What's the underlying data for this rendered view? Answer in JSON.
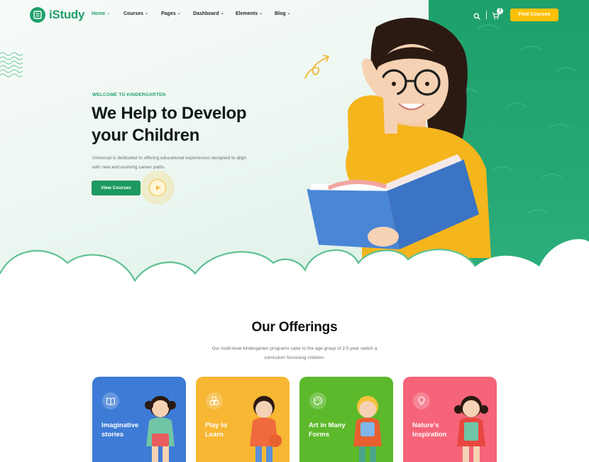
{
  "brand": {
    "name": "iStudy"
  },
  "nav": {
    "items": [
      {
        "label": "Home",
        "active": true
      },
      {
        "label": "Courses",
        "active": false
      },
      {
        "label": "Pages",
        "active": false
      },
      {
        "label": "Dashboard",
        "active": false
      },
      {
        "label": "Elements",
        "active": false
      },
      {
        "label": "Blog",
        "active": false
      }
    ],
    "cart_count": "3",
    "cta_label": "Find Courses"
  },
  "hero": {
    "eyebrow": "WELCOME TO KINDERGARTEN",
    "title_line1": "We Help to Develop",
    "title_line2": "your Children",
    "description": "Universal is dedicated to offering educational experiences designed to align with new and evolving career paths.",
    "button_label": "View Courses"
  },
  "offerings": {
    "title": "Our Offerings",
    "description": "Our multi-level kindergarten programs cater to the age group of 2-5 year switch a curriculum focussing children.",
    "cards": [
      {
        "line1": "Imaginative",
        "line2": "stories",
        "icon": "book-icon",
        "color": "#3d7bd6"
      },
      {
        "line1": "Play to",
        "line2": "Learn",
        "icon": "blocks-icon",
        "color": "#f7b733"
      },
      {
        "line1": "Art in Many",
        "line2": "Forms",
        "icon": "palette-icon",
        "color": "#5cb92b"
      },
      {
        "line1": "Nature's",
        "line2": "Inspiration",
        "icon": "bulb-icon",
        "color": "#f56479"
      }
    ]
  },
  "colors": {
    "brand_green": "#1fa06a",
    "accent_yellow": "#ffc107"
  }
}
